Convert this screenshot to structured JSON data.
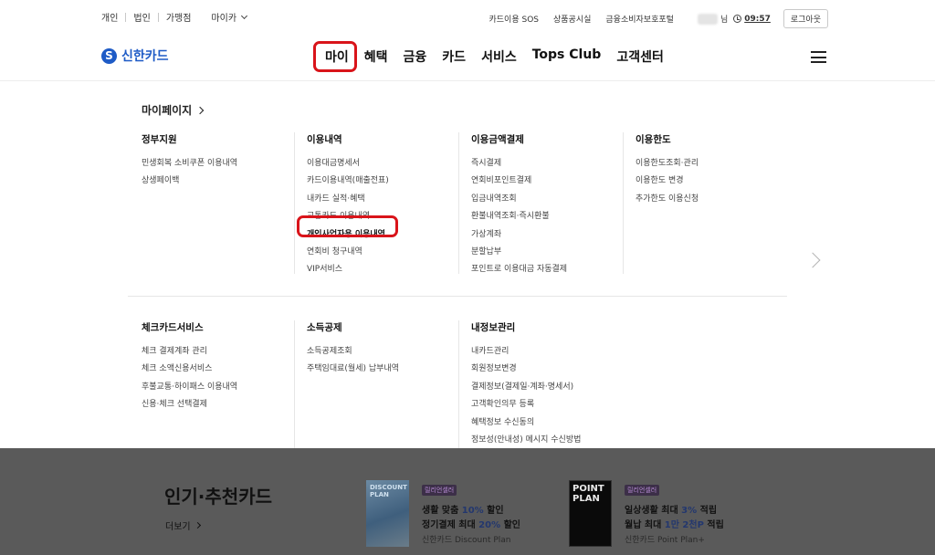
{
  "util_left": [
    "개인",
    "법인",
    "가맹점"
  ],
  "util_dropdown": "마이카",
  "util_right": {
    "links": [
      "카드이용 SOS",
      "상품공시실",
      "금융소비자보호포털"
    ],
    "user_suffix": "님",
    "time": "09:57",
    "logout": "로그아웃"
  },
  "brand": {
    "mark": "S",
    "name": "신한카드",
    "color": "#1e5bc6"
  },
  "nav": [
    "마이",
    "혜택",
    "금융",
    "카드",
    "서비스",
    "Tops Club",
    "고객센터"
  ],
  "highlight_color": "#d9141a",
  "mypage_title": "마이페이지",
  "columns_top": [
    {
      "title": "정부지원",
      "items": [
        "민생회복 소비쿠폰 이용내역",
        "상생페이백"
      ]
    },
    {
      "title": "이용내역",
      "items": [
        "이용대금명세서",
        "카드이용내역(매출전표)",
        "내카드 실적·혜택",
        "교통카드 이용내역",
        "개인사업자용 이용내역",
        "연회비 청구내역",
        "VIP서비스"
      ]
    },
    {
      "title": "이용금액결제",
      "items": [
        "즉시결제",
        "연회비포인트결제",
        "입금내역조회",
        "환불내역조회·즉시환불",
        "가상계좌",
        "분할납부",
        "포인트로 이용대금 자동결제"
      ]
    },
    {
      "title": "이용한도",
      "items": [
        "이용한도조회·관리",
        "이용한도 변경",
        "추가한도 이용신청"
      ]
    }
  ],
  "columns_bottom": [
    {
      "title": "체크카드서비스",
      "items": [
        "체크 결제계좌 관리",
        "체크 소액신용서비스",
        "후불교통·하이패스 이용내역",
        "신용·체크 선택결제"
      ]
    },
    {
      "title": "소득공제",
      "items": [
        "소득공제조회",
        "주택임대료(월세) 납부내역"
      ]
    },
    {
      "title": "내정보관리",
      "items": [
        "내카드관리",
        "회원정보변경",
        "결제정보(결제일·계좌·명세서)",
        "고객확인의무 등록",
        "혜택정보 수신동의",
        "정보성(안내성) 메시지 수신방법"
      ]
    }
  ],
  "recommend": {
    "title": "인기·추천카드",
    "more": "더보기",
    "cards": [
      {
        "badge": "릴리언셀러",
        "line1_pre": "생활 맞춤 ",
        "line1_em": "10%",
        "line1_post": " 할인",
        "line2_pre": "정기결제 최대 ",
        "line2_em": "20%",
        "line2_post": " 할인",
        "name": "신한카드 Discount Plan",
        "art": "DISCOUNT PLAN"
      },
      {
        "badge": "릴리언셀러",
        "line1_pre": "일상생활 최대 ",
        "line1_em": "3%",
        "line1_post": " 적립",
        "line2_pre": "월납 최대 ",
        "line2_em": "1만 2천P",
        "line2_post": " 적립",
        "name": "신한카드 Point Plan+",
        "art": "POINT PLAN"
      }
    ]
  }
}
